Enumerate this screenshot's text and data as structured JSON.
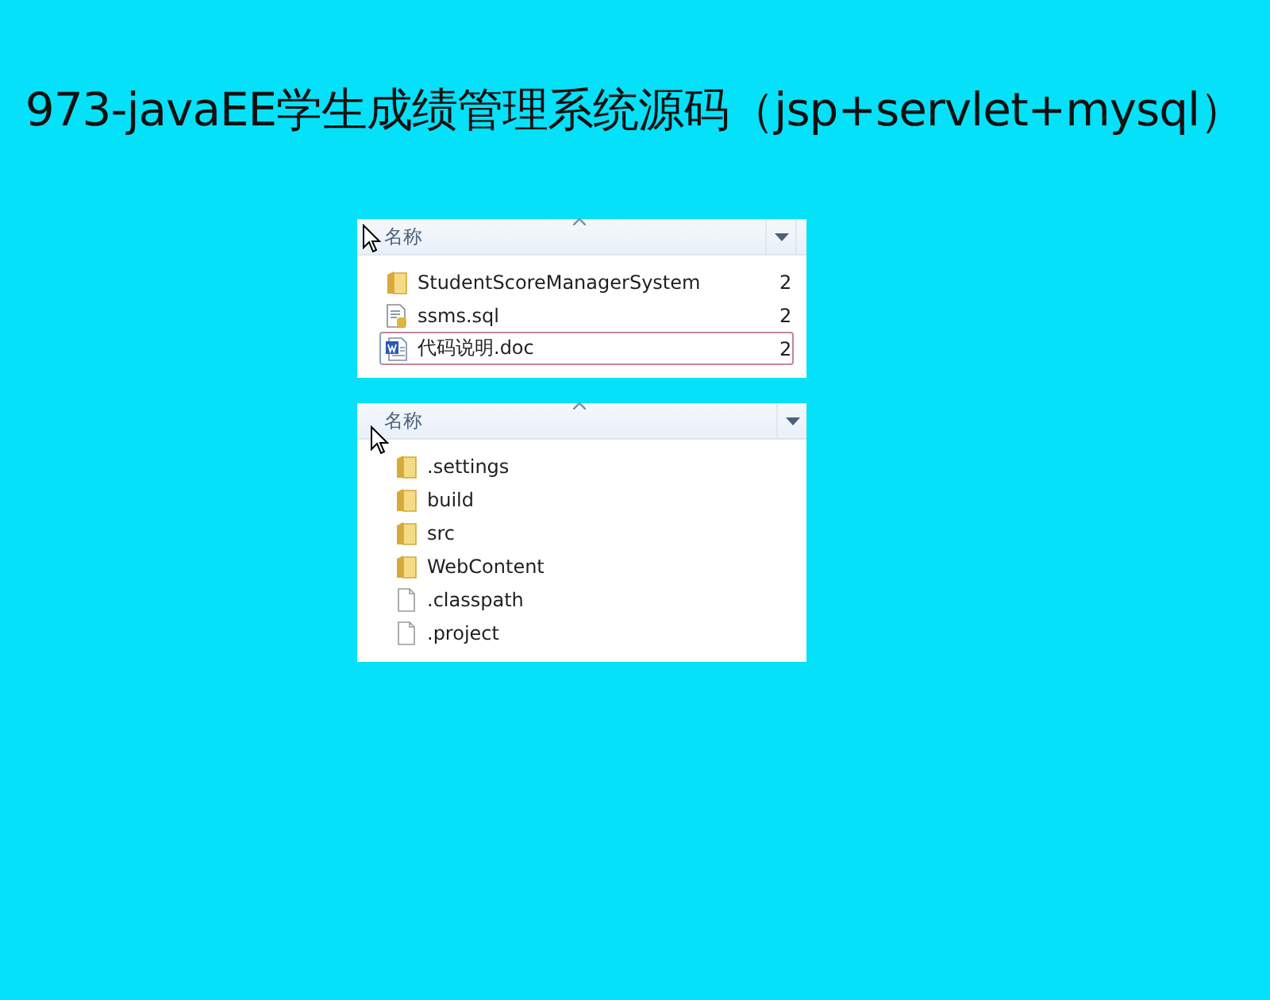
{
  "title": "973-javaEE学生成绩管理系统源码（jsp+servlet+mysql）",
  "panels": [
    {
      "column_header": "名称",
      "items": [
        {
          "name": "StudentScoreManagerSystem",
          "kind": "folder",
          "column_2": "2",
          "selected": false
        },
        {
          "name": "ssms.sql",
          "kind": "sql",
          "column_2": "2",
          "selected": false
        },
        {
          "name": "代码说明.doc",
          "kind": "word",
          "column_2": "2",
          "selected": true
        }
      ]
    },
    {
      "column_header": "名称",
      "items": [
        {
          "name": ".settings",
          "kind": "folder",
          "selected": false
        },
        {
          "name": "build",
          "kind": "folder",
          "selected": false
        },
        {
          "name": "src",
          "kind": "folder",
          "selected": false
        },
        {
          "name": "WebContent",
          "kind": "folder",
          "selected": false
        },
        {
          "name": ".classpath",
          "kind": "file",
          "selected": false
        },
        {
          "name": ".project",
          "kind": "file",
          "selected": false
        }
      ]
    }
  ]
}
